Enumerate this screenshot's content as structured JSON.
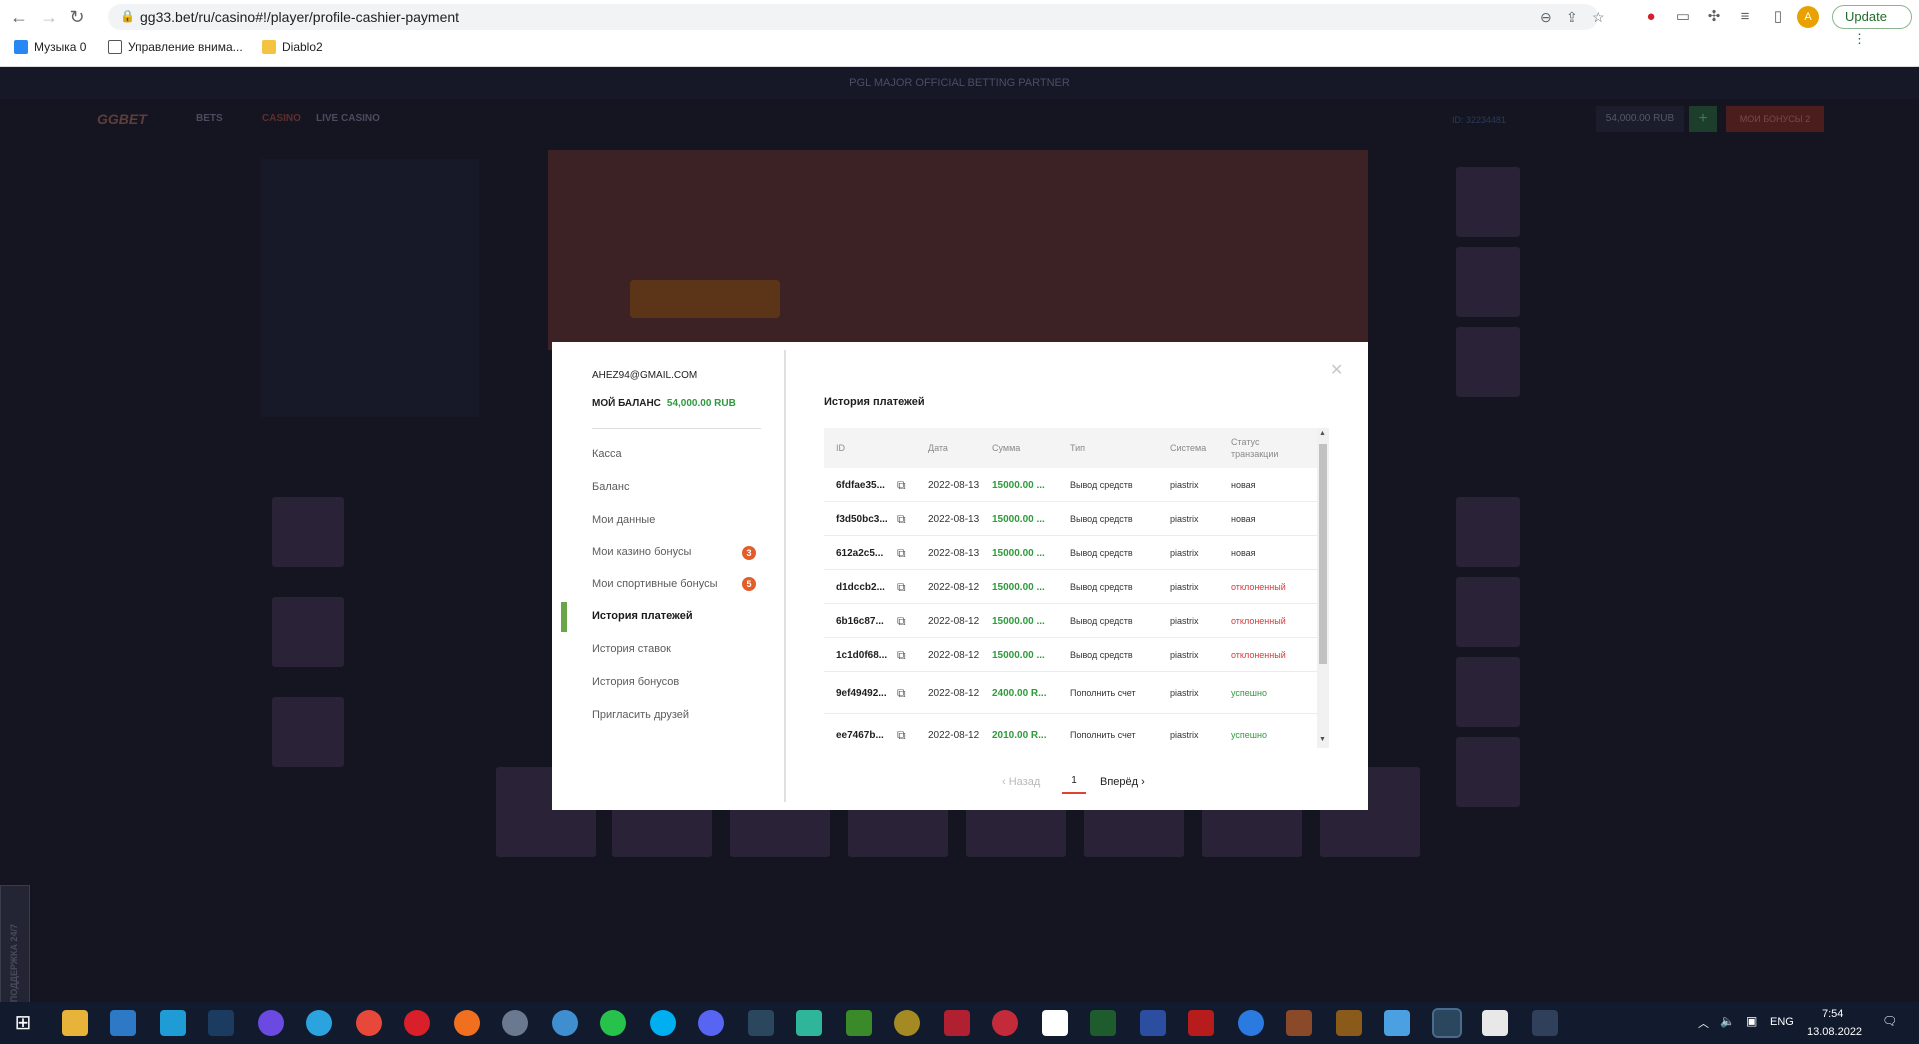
{
  "browser": {
    "url": "gg33.bet/ru/casino#!/player/profile-cashier-payment",
    "update_label": "Update",
    "bookmarks": [
      "Музыка 0",
      "Управление внима...",
      "Diablo2"
    ]
  },
  "site": {
    "partner_text": "PGL MAJOR OFFICIAL BETTING PARTNER",
    "logo": "GGBET",
    "nav": [
      "BETS",
      "CASINO",
      "LIVE CASINO"
    ],
    "user_id": "ID: 32234481",
    "balance": "54,000.00 RUB",
    "plus": "+",
    "bonus_button": "МОИ БОНУСЫ",
    "bonus_count": "2",
    "support_tab": "ПОДДЕРЖКА 24/7"
  },
  "modal": {
    "email": "AHEZ94@GMAIL.COM",
    "balance_label": "МОЙ БАЛАНС",
    "balance_value": "54,000.00 RUB",
    "menu": [
      {
        "label": "Касса"
      },
      {
        "label": "Баланс"
      },
      {
        "label": "Мои данные"
      },
      {
        "label": "Мои казино бонусы",
        "badge": "3"
      },
      {
        "label": "Мои спортивные бонусы",
        "badge": "5"
      },
      {
        "label": "История платежей",
        "active": true
      },
      {
        "label": "История ставок"
      },
      {
        "label": "История бонусов"
      },
      {
        "label": "Пригласить друзей"
      }
    ],
    "title": "История платежей",
    "columns": [
      "ID",
      "Дата",
      "Сумма",
      "Тип",
      "Система",
      "Статус транзакции"
    ],
    "rows": [
      {
        "id": "6fdfae35...",
        "date": "2022-08-13",
        "sum": "15000.00 ...",
        "type": "Вывод средств",
        "system": "piastrix",
        "status": "новая",
        "kind": "new"
      },
      {
        "id": "f3d50bc3...",
        "date": "2022-08-13",
        "sum": "15000.00 ...",
        "type": "Вывод средств",
        "system": "piastrix",
        "status": "новая",
        "kind": "new"
      },
      {
        "id": "612a2c5...",
        "date": "2022-08-13",
        "sum": "15000.00 ...",
        "type": "Вывод средств",
        "system": "piastrix",
        "status": "новая",
        "kind": "new"
      },
      {
        "id": "d1dccb2...",
        "date": "2022-08-12",
        "sum": "15000.00 ...",
        "type": "Вывод средств",
        "system": "piastrix",
        "status": "отклоненный",
        "kind": "rej"
      },
      {
        "id": "6b16c87...",
        "date": "2022-08-12",
        "sum": "15000.00 ...",
        "type": "Вывод средств",
        "system": "piastrix",
        "status": "отклоненный",
        "kind": "rej"
      },
      {
        "id": "1c1d0f68...",
        "date": "2022-08-12",
        "sum": "15000.00 ...",
        "type": "Вывод средств",
        "system": "piastrix",
        "status": "отклоненный",
        "kind": "rej"
      },
      {
        "id": "9ef49492...",
        "date": "2022-08-12",
        "sum": "2400.00 R...",
        "type": "Пополнить счет",
        "system": "piastrix",
        "status": "успешно",
        "kind": "ok"
      },
      {
        "id": "ee7467b...",
        "date": "2022-08-12",
        "sum": "2010.00 R...",
        "type": "Пополнить счет",
        "system": "piastrix",
        "status": "успешно",
        "kind": "ok"
      }
    ],
    "pager": {
      "prev": "Назад",
      "current": "1",
      "next": "Вперёд"
    }
  },
  "taskbar": {
    "lang": "ENG",
    "time": "7:54",
    "date": "13.08.2022"
  },
  "colors": {
    "accent_green": "#2e9a3c",
    "rejected_red": "#d43a3a",
    "active_bar": "#6aa548",
    "badge": "#e15d2a"
  }
}
